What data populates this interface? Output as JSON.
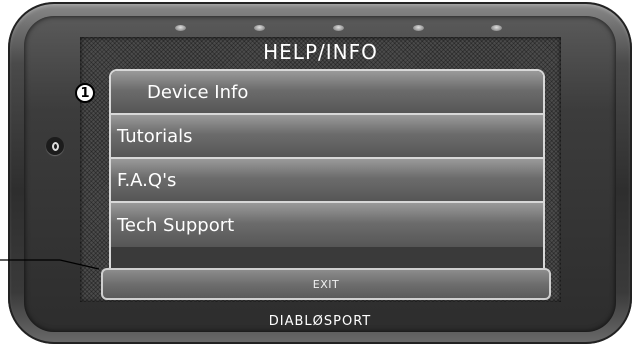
{
  "screen": {
    "title": "HELP/INFO",
    "menu_items": [
      {
        "label": "Device Info"
      },
      {
        "label": "Tutorials"
      },
      {
        "label": "F.A.Q's"
      },
      {
        "label": "Tech Support"
      }
    ],
    "exit_label": "EXIT"
  },
  "device": {
    "brand": "DIABLØSPORT",
    "indicator_leds": 5,
    "side_button_icon": "power-icon"
  },
  "annotation": {
    "callout_number": "1"
  },
  "colors": {
    "screen_background": "#4b4b4b",
    "menu_border": "#d8d8d8",
    "text": "#ffffff"
  }
}
